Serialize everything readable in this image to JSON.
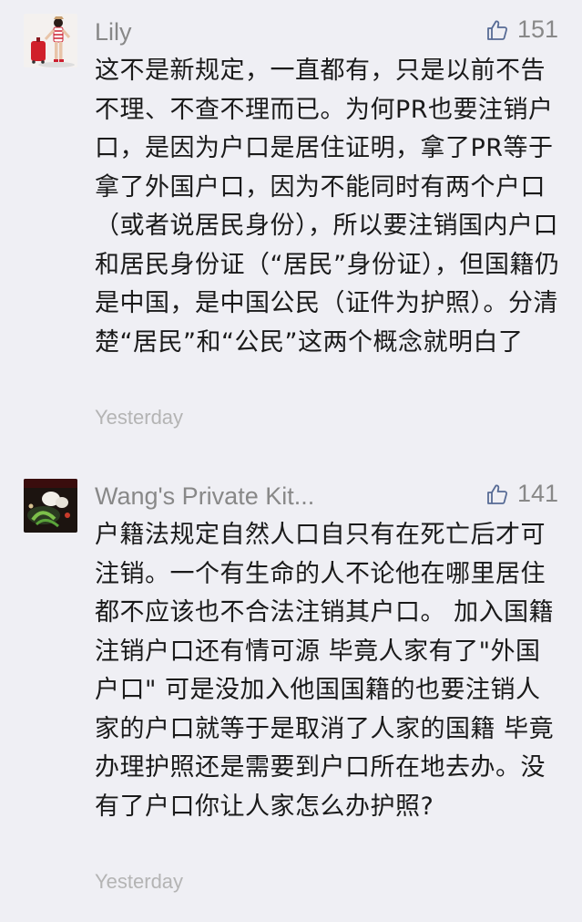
{
  "comments": [
    {
      "username": "Lily",
      "likes": "151",
      "content": "这不是新规定，一直都有，只是以前不告不理、不查不理而已。为何PR也要注销户口，是因为户口是居住证明，拿了PR等于拿了外国户口，因为不能同时有两个户口（或者说居民身份），所以要注销国内户口和居民身份证（“居民”身份证），但国籍仍是中国，是中国公民（证件为护照）。分清楚“居民”和“公民”这两个概念就明白了",
      "time": "Yesterday",
      "avatar_icon": "traveler-with-red-suitcase"
    },
    {
      "username": "Wang's Private Kit...",
      "likes": "141",
      "content": "户籍法规定自然人口自只有在死亡后才可注销。一个有生命的人不论他在哪里居住都不应该也不合法注销其户口。 加入国籍注销户口还有情可源 毕竟人家有了\"外国户口\" 可是没加入他国国籍的也要注销人家的户口就等于是取消了人家的国籍 毕竟办理护照还是需要到户口所在地去办。没有了户口你让人家怎么办护照?",
      "time": "Yesterday",
      "avatar_icon": "food-plate-photo"
    }
  ],
  "colors": {
    "background": "#efeff4",
    "meta_text": "#888888",
    "body_text": "#1a1a1a",
    "time_text": "#b4b4b4"
  }
}
